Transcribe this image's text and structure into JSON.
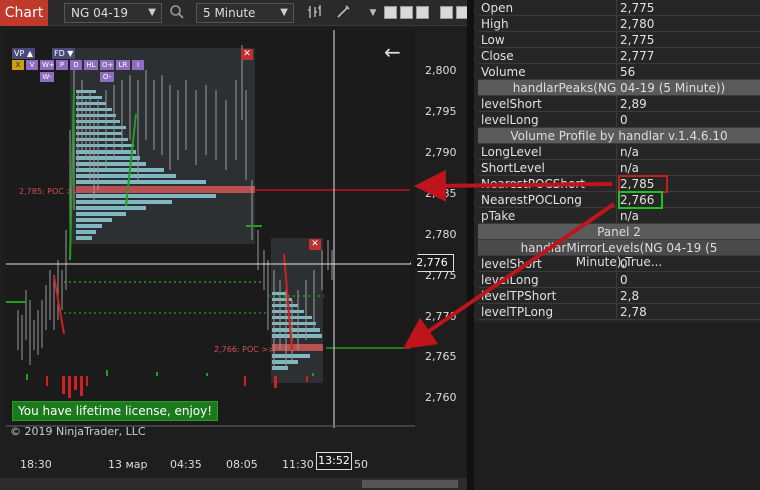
{
  "toolbar": {
    "chart_tab": "Chart",
    "instrument": "NG 04-19",
    "interval": "5 Minute"
  },
  "indicator_chips": {
    "vp": "VP ▲",
    "fd": "FD ▼",
    "row1": [
      "X",
      "V",
      "W+",
      "P",
      "D",
      "HL",
      "O+",
      "LR",
      "I"
    ],
    "row2": [
      "W-",
      "O-"
    ]
  },
  "chart": {
    "y_ticks": [
      "2,800",
      "2,795",
      "2,790",
      "2,785",
      "2,780",
      "2,775",
      "2,770",
      "2,765",
      "2,760"
    ],
    "x_ticks": [
      "18:30",
      "13 мар",
      "04:35",
      "08:05",
      "11:30",
      "50"
    ],
    "current_price": "2,776",
    "current_time": "13:52",
    "poc_label_1": "2,785: POC >>",
    "poc_label_2": "2,766: POC >>",
    "license_msg": "You have lifetime license, enjoy!",
    "copyright": "© 2019 NinjaTrader, LLC",
    "close_glyph": "✕",
    "back_arrow": "←"
  },
  "databox": {
    "rows": [
      {
        "k": "Open",
        "v": "2,775"
      },
      {
        "k": "High",
        "v": "2,780"
      },
      {
        "k": "Low",
        "v": "2,775"
      },
      {
        "k": "Close",
        "v": "2,777"
      },
      {
        "k": "Volume",
        "v": "56"
      }
    ],
    "hdr1": "handlarPeaks(NG 04-19 (5 Minute))",
    "rows2": [
      {
        "k": "levelShort",
        "v": "2,89"
      },
      {
        "k": "levelLong",
        "v": "0"
      }
    ],
    "hdr2": "Volume Profile by handlar v.1.4.6.10",
    "rows3": [
      {
        "k": "LongLevel",
        "v": "n/a"
      },
      {
        "k": "ShortLevel",
        "v": "n/a"
      },
      {
        "k": "NearestPOCShort",
        "v": "2,785"
      },
      {
        "k": "NearestPOCLong",
        "v": "2,766"
      },
      {
        "k": "pTake",
        "v": "n/a"
      }
    ],
    "hdr3": "Panel 2",
    "hdr4": "handlarMirrorLevels(NG 04-19 (5 Minute),True...",
    "rows4": [
      {
        "k": "levelShort",
        "v": "0"
      },
      {
        "k": "levelLong",
        "v": "0"
      },
      {
        "k": "levelTPShort",
        "v": "2,8"
      },
      {
        "k": "levelTPLong",
        "v": "2,78"
      }
    ]
  },
  "colors": {
    "poc": "#b85050",
    "profile": "#7fb8c0",
    "arrow": "#c0141c",
    "accent": "#c0392b"
  }
}
